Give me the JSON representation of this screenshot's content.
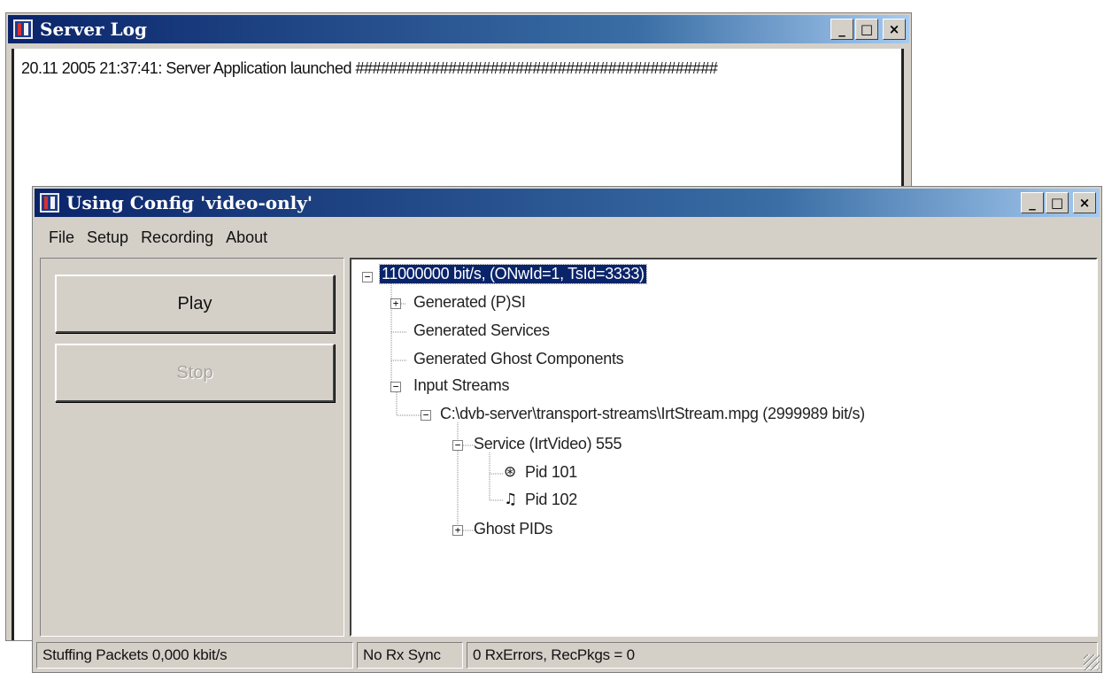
{
  "server_log": {
    "title": "Server Log",
    "log_line": "20.11 2005 21:37:41: Server Application launched ###########################################"
  },
  "config_window": {
    "title": "Using Config 'video-only'",
    "menu": [
      "File",
      "Setup",
      "Recording",
      "About"
    ],
    "buttons": {
      "play": "Play",
      "stop": "Stop"
    },
    "tree": {
      "root": "11000000 bit/s, (ONwId=1, TsId=3333)",
      "generated_psi": "Generated (P)SI",
      "generated_services": "Generated Services",
      "generated_ghost": "Generated Ghost Components",
      "input_streams": "Input Streams",
      "stream_file": "C:\\dvb-server\\transport-streams\\IrtStream.mpg (2999989 bit/s)",
      "service": "Service (IrtVideo) 555",
      "pid_video": "Pid 101",
      "pid_audio": "Pid 102",
      "ghost_pids": "Ghost PIDs"
    },
    "status": {
      "stuffing": "Stuffing Packets 0,000 kbit/s",
      "sync": "No Rx Sync",
      "errors": "0 RxErrors, RecPkgs = 0"
    }
  },
  "window_buttons": {
    "minimize": "_",
    "maximize": "□",
    "close": "×"
  },
  "icons": {
    "app": "app-logo-icon",
    "video_pid": "camera-icon",
    "audio_pid": "music-note-icon"
  },
  "colors": {
    "titlebar_start": "#0a246a",
    "titlebar_end": "#a6caf0",
    "selection": "#0a246a",
    "window_face": "#d4d0c8"
  }
}
